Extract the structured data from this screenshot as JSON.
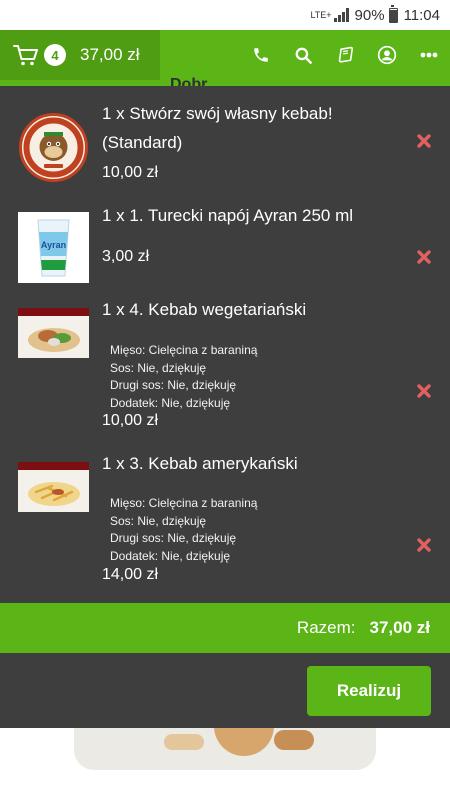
{
  "status_bar": {
    "network": "LTE+",
    "battery": "90%",
    "time": "11:04"
  },
  "topbar": {
    "cart_count": "4",
    "cart_total": "37,00 zł",
    "icons": [
      "phone-icon",
      "search-icon",
      "menu-book-icon",
      "account-icon",
      "more-icon"
    ]
  },
  "background_page": {
    "partial_title": "Dobr"
  },
  "cart": {
    "items": [
      {
        "title": "1 x Stwórz swój własny kebab!",
        "subtitle": "(Standard)",
        "price": "10,00 zł",
        "image": "kebab-u-yogiego-logo"
      },
      {
        "title": "1 x 1. Turecki napój Ayran 250 ml",
        "price": "3,00 zł",
        "image": "ayran-cup"
      },
      {
        "title": "1 x 4. Kebab wegetariański",
        "options": [
          "Mięso: Cielęcina z baraniną",
          "Sos: Nie, dziękuję",
          "Drugi sos: Nie, dziękuję",
          "Dodatek: Nie, dziękuję"
        ],
        "price": "10,00 zł",
        "image": "kebab-photo"
      },
      {
        "title": "1 x 3. Kebab amerykański",
        "options": [
          "Mięso: Cielęcina z baraniną",
          "Sos: Nie, dziękuję",
          "Drugi sos: Nie, dziękuję",
          "Dodatek: Nie, dziękuję"
        ],
        "price": "14,00 zł",
        "image": "fries-photo"
      }
    ],
    "total_label": "Razem:",
    "total_value": "37,00 zł",
    "checkout_label": "Realizuj"
  },
  "colors": {
    "accent_green": "#5bb516",
    "dark_green": "#4e9d13",
    "panel_bg": "#3e3e3e",
    "remove_red": "#e26060"
  }
}
